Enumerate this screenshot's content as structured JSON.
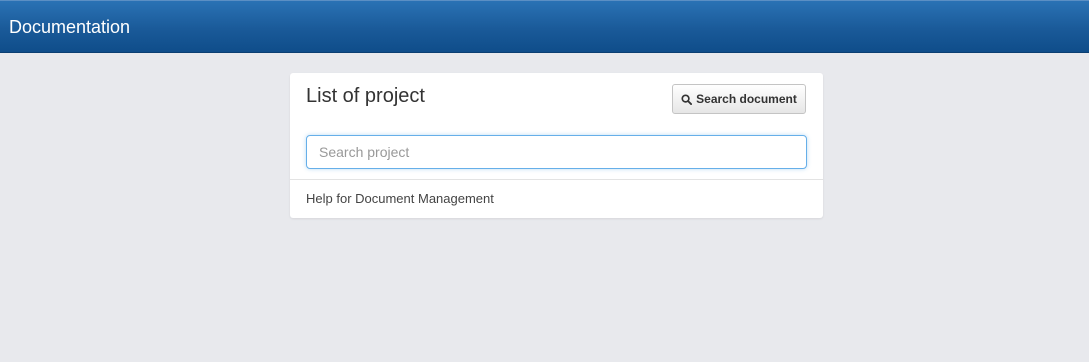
{
  "header": {
    "brand": "Documentation"
  },
  "panel": {
    "title": "List of project",
    "search_document_button": {
      "label": "Search document",
      "icon": "search-icon"
    },
    "search_input": {
      "value": "",
      "placeholder": "Search project"
    },
    "projects": [
      {
        "label": "Help for Document Management"
      }
    ]
  },
  "colors": {
    "header_top": "#2a72b5",
    "header_bottom": "#0f4d8a",
    "page_background": "#e8e9ed",
    "focus_border": "#66afe9"
  }
}
